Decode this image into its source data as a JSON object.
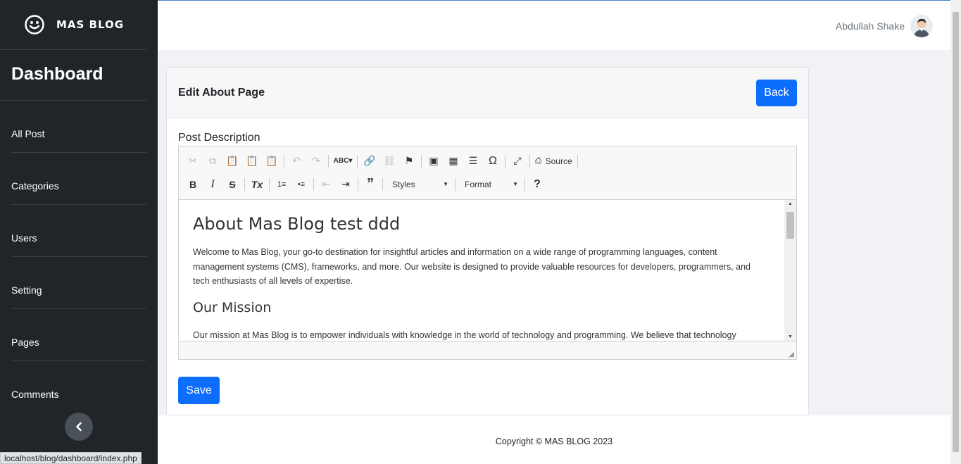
{
  "brand": {
    "name": "MAS BLOG",
    "icon": "smiley-icon"
  },
  "sidebar": {
    "title": "Dashboard",
    "items": [
      {
        "label": "All Post"
      },
      {
        "label": "Categories"
      },
      {
        "label": "Users"
      },
      {
        "label": "Setting"
      },
      {
        "label": "Pages"
      },
      {
        "label": "Comments"
      }
    ]
  },
  "header": {
    "user_name": "Abdullah Shake"
  },
  "card": {
    "title": "Edit About Page",
    "back_label": "Back",
    "field_label": "Post Description",
    "save_label": "Save"
  },
  "editor": {
    "toolbar": {
      "source_label": "Source",
      "styles_label": "Styles",
      "format_label": "Format"
    },
    "content": {
      "heading": "About Mas Blog test ddd",
      "paragraph": "Welcome to Mas Blog, your go-to destination for insightful articles and information on a wide range of programming languages, content management systems (CMS), frameworks, and more. Our website is designed to provide valuable resources for developers, programmers, and tech enthusiasts of all levels of expertise.",
      "subheading": "Our Mission",
      "paragraph2": "Our mission at Mas Blog is to empower individuals with knowledge in the world of technology and programming. We believe that technology"
    }
  },
  "footer": {
    "copyright": "Copyright © MAS BLOG 2023"
  },
  "status_url": "localhost/blog/dashboard/index.php",
  "colors": {
    "sidebar_bg": "#212529",
    "primary": "#0d6efd"
  }
}
